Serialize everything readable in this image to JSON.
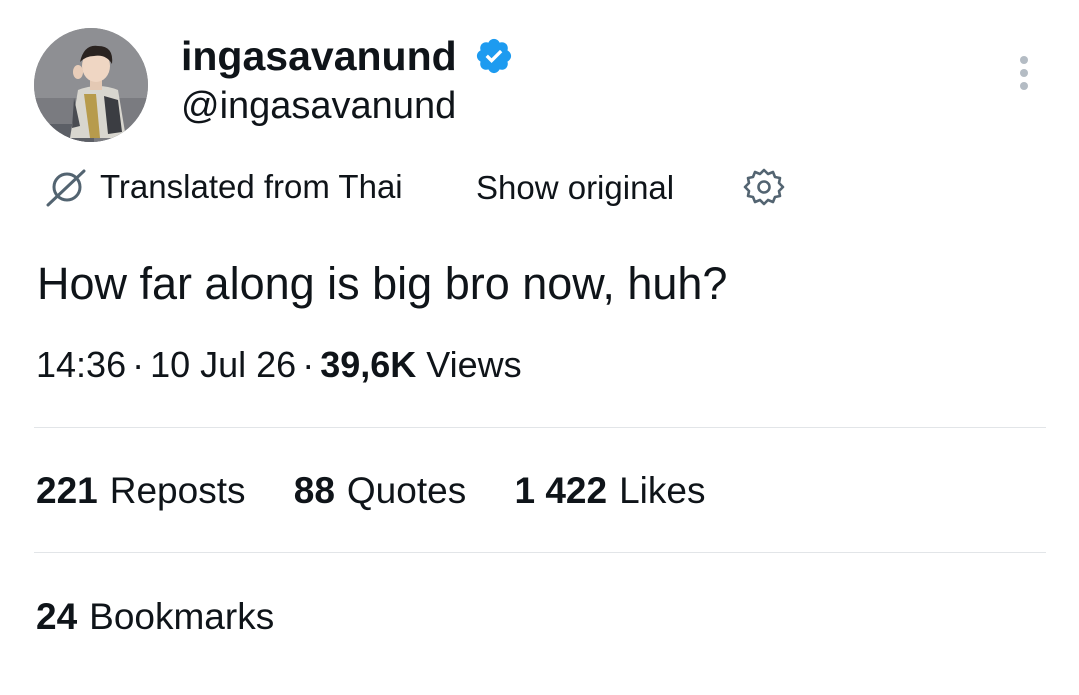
{
  "author": {
    "display_name": "ingasavanund",
    "handle": "@ingasavanund",
    "verified": true,
    "verified_color": "#1d9bf0"
  },
  "icons": {
    "verified": "verified-badge-icon",
    "more": "more-options-icon",
    "translate": "translate-icon",
    "settings": "gear-icon"
  },
  "translation": {
    "label": "Translated from Thai",
    "show_original": "Show original"
  },
  "tweet": {
    "text": "How far along is big bro now, huh?",
    "time": "14:36",
    "separator": "·",
    "date": "10 Jul 26",
    "views_count": "39,6K",
    "views_label": "Views"
  },
  "engagement": {
    "reposts_count": "221",
    "reposts_label": "Reposts",
    "quotes_count": "88",
    "quotes_label": "Quotes",
    "likes_count": "1 422",
    "likes_label": "Likes",
    "bookmarks_count": "24",
    "bookmarks_label": "Bookmarks"
  }
}
